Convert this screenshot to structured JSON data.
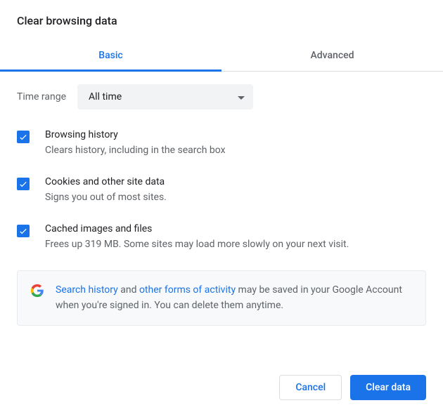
{
  "title": "Clear browsing data",
  "tabs": {
    "basic": "Basic",
    "advanced": "Advanced"
  },
  "timeRange": {
    "label": "Time range",
    "value": "All time"
  },
  "options": [
    {
      "title": "Browsing history",
      "desc": "Clears history, including in the search box"
    },
    {
      "title": "Cookies and other site data",
      "desc": "Signs you out of most sites."
    },
    {
      "title": "Cached images and files",
      "desc": "Frees up 319 MB. Some sites may load more slowly on your next visit."
    }
  ],
  "notice": {
    "link1": "Search history",
    "mid1": " and ",
    "link2": "other forms of activity",
    "rest": " may be saved in your Google Account when you're signed in. You can delete them anytime."
  },
  "buttons": {
    "cancel": "Cancel",
    "clear": "Clear data"
  }
}
